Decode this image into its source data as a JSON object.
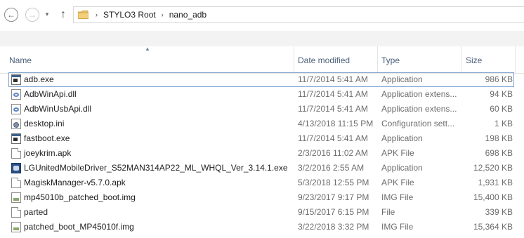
{
  "nav": {
    "breadcrumb_sep": "›",
    "breadcrumbs": [
      "STYLO3 Root",
      "nano_adb"
    ]
  },
  "columns": {
    "name": "Name",
    "date": "Date modified",
    "type": "Type",
    "size": "Size"
  },
  "files": [
    {
      "name": "adb.exe",
      "date": "11/7/2014 5:41 AM",
      "type": "Application",
      "size": "986 KB",
      "icon": "application-icon"
    },
    {
      "name": "AdbWinApi.dll",
      "date": "11/7/2014 5:41 AM",
      "type": "Application extens...",
      "size": "94 KB",
      "icon": "dll-icon"
    },
    {
      "name": "AdbWinUsbApi.dll",
      "date": "11/7/2014 5:41 AM",
      "type": "Application extens...",
      "size": "60 KB",
      "icon": "dll-icon"
    },
    {
      "name": "desktop.ini",
      "date": "4/13/2018 11:15 PM",
      "type": "Configuration sett...",
      "size": "1 KB",
      "icon": "settings-file-icon"
    },
    {
      "name": "fastboot.exe",
      "date": "11/7/2014 5:41 AM",
      "type": "Application",
      "size": "198 KB",
      "icon": "application-icon"
    },
    {
      "name": "joeykrim.apk",
      "date": "2/3/2016 11:02 AM",
      "type": "APK File",
      "size": "698 KB",
      "icon": "file-icon"
    },
    {
      "name": "LGUnitedMobileDriver_S52MAN314AP22_ML_WHQL_Ver_3.14.1.exe",
      "date": "3/2/2016 2:55 AM",
      "type": "Application",
      "size": "12,520 KB",
      "icon": "installer-icon"
    },
    {
      "name": "MagiskManager-v5.7.0.apk",
      "date": "5/3/2018 12:55 PM",
      "type": "APK File",
      "size": "1,931 KB",
      "icon": "file-icon"
    },
    {
      "name": "mp45010b_patched_boot.img",
      "date": "9/23/2017 9:17 PM",
      "type": "IMG File",
      "size": "15,400 KB",
      "icon": "image-file-icon"
    },
    {
      "name": "parted",
      "date": "9/15/2017 6:15 PM",
      "type": "File",
      "size": "339 KB",
      "icon": "file-icon"
    },
    {
      "name": "patched_boot_MP45010f.img",
      "date": "3/22/2018 3:32 PM",
      "type": "IMG File",
      "size": "15,364 KB",
      "icon": "image-file-icon"
    }
  ],
  "selected_index": 0
}
